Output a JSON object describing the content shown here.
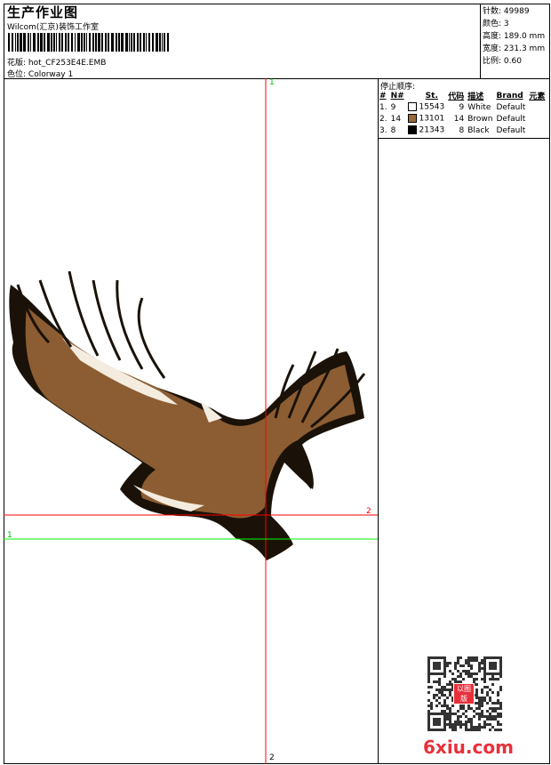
{
  "header": {
    "title": "生产作业图",
    "company": "Wilcom(汇京)装饰工作室",
    "design_label": "花版:",
    "design_value": "hot_CF253E4E.EMB",
    "colorway_label": "色位:",
    "colorway_value": "Colorway 1"
  },
  "stats": [
    {
      "label": "针数:",
      "value": "49989"
    },
    {
      "label": "颜色:",
      "value": "3"
    },
    {
      "label": "高度:",
      "value": "189.0 mm"
    },
    {
      "label": "宽度:",
      "value": "231.3 mm"
    },
    {
      "label": "比例:",
      "value": "0.60"
    }
  ],
  "stop_sequence": {
    "title": "停止顺序:",
    "columns": [
      "#",
      "N#",
      "St.",
      "代码",
      "描述",
      "Brand",
      "元素"
    ],
    "rows": [
      {
        "idx": "1.",
        "n": "9",
        "color": "#ffffff",
        "st": "15543",
        "code": "9",
        "desc": "White",
        "brand": "Default"
      },
      {
        "idx": "2.",
        "n": "14",
        "color": "#9a6a3a",
        "st": "13101",
        "code": "14",
        "desc": "Brown",
        "brand": "Default"
      },
      {
        "idx": "3.",
        "n": "8",
        "color": "#000000",
        "st": "21343",
        "code": "8",
        "desc": "Black",
        "brand": "Default"
      }
    ]
  },
  "guides": {
    "v_top": "1",
    "v_bottom": "2",
    "h_red": "2",
    "h_green": "1"
  },
  "colors": {
    "guide_red": "#ff0000",
    "guide_green": "#00ff00",
    "watermark": "#e8303a"
  },
  "watermark": {
    "text": "6xiu.com",
    "stamp": "以图版"
  }
}
